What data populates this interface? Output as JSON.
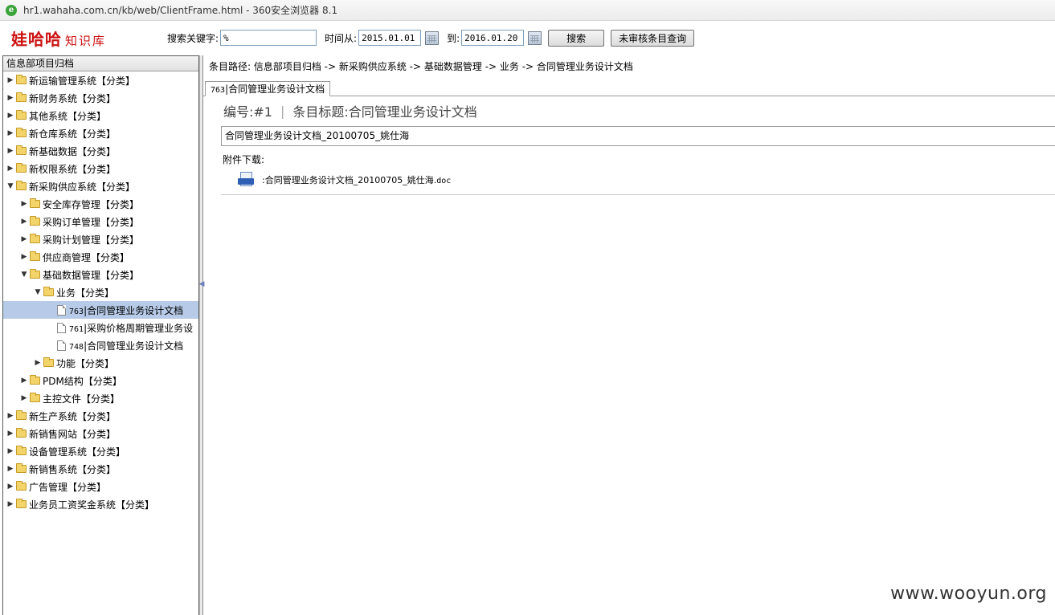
{
  "browser": {
    "title": "hr1.wahaha.com.cn/kb/web/ClientFrame.html - 360安全浏览器 8.1",
    "logo_glyph": "e"
  },
  "toolbar": {
    "logo_main": "娃哈哈",
    "logo_sub": "知识库",
    "keyword_label": "搜索关键字:",
    "keyword_value": "%",
    "time_from_label": "时间从:",
    "date_from": "2015.01.01",
    "time_to_label": "到:",
    "date_to": "2016.01.20",
    "search_button": "搜索",
    "unreviewed_button": "未审核条目查询"
  },
  "left_panel": {
    "header": "信息部项目归档",
    "tree": [
      {
        "label": "新运输管理系统【分类】",
        "indent": 0,
        "arrow": "▶",
        "icon": "folder"
      },
      {
        "label": "新财务系统【分类】",
        "indent": 0,
        "arrow": "▶",
        "icon": "folder"
      },
      {
        "label": "其他系统【分类】",
        "indent": 0,
        "arrow": "▶",
        "icon": "folder"
      },
      {
        "label": "新仓库系统【分类】",
        "indent": 0,
        "arrow": "▶",
        "icon": "folder"
      },
      {
        "label": "新基础数据【分类】",
        "indent": 0,
        "arrow": "▶",
        "icon": "folder"
      },
      {
        "label": "新权限系统【分类】",
        "indent": 0,
        "arrow": "▶",
        "icon": "folder"
      },
      {
        "label": "新采购供应系统【分类】",
        "indent": 0,
        "arrow": "▼",
        "icon": "folder"
      },
      {
        "label": "安全库存管理【分类】",
        "indent": 1,
        "arrow": "▶",
        "icon": "folder"
      },
      {
        "label": "采购订单管理【分类】",
        "indent": 1,
        "arrow": "▶",
        "icon": "folder"
      },
      {
        "label": "采购计划管理【分类】",
        "indent": 1,
        "arrow": "▶",
        "icon": "folder"
      },
      {
        "label": "供应商管理【分类】",
        "indent": 1,
        "arrow": "▶",
        "icon": "folder"
      },
      {
        "label": "基础数据管理【分类】",
        "indent": 1,
        "arrow": "▼",
        "icon": "folder"
      },
      {
        "label": "业务【分类】",
        "indent": 2,
        "arrow": "▼",
        "icon": "folder"
      },
      {
        "id": "763",
        "label": "|合同管理业务设计文档",
        "indent": 3,
        "arrow": "",
        "icon": "doc",
        "selected": true
      },
      {
        "id": "761",
        "label": "|采购价格周期管理业务设",
        "indent": 3,
        "arrow": "",
        "icon": "doc"
      },
      {
        "id": "748",
        "label": "|合同管理业务设计文档",
        "indent": 3,
        "arrow": "",
        "icon": "doc"
      },
      {
        "label": "功能【分类】",
        "indent": 2,
        "arrow": "▶",
        "icon": "folder"
      },
      {
        "label": "PDM结构【分类】",
        "indent": 1,
        "arrow": "▶",
        "icon": "folder"
      },
      {
        "label": "主控文件【分类】",
        "indent": 1,
        "arrow": "▶",
        "icon": "folder"
      },
      {
        "label": "新生产系统【分类】",
        "indent": 0,
        "arrow": "▶",
        "icon": "folder"
      },
      {
        "label": "新销售网站【分类】",
        "indent": 0,
        "arrow": "▶",
        "icon": "folder"
      },
      {
        "label": "设备管理系统【分类】",
        "indent": 0,
        "arrow": "▶",
        "icon": "folder"
      },
      {
        "label": "新销售系统【分类】",
        "indent": 0,
        "arrow": "▶",
        "icon": "folder"
      },
      {
        "label": "广告管理【分类】",
        "indent": 0,
        "arrow": "▶",
        "icon": "folder"
      },
      {
        "label": "业务员工资奖金系统【分类】",
        "indent": 0,
        "arrow": "▶",
        "icon": "folder"
      }
    ]
  },
  "main": {
    "breadcrumb": "条目路径: 信息部项目归档 -> 新采购供应系统 -> 基础数据管理 -> 业务 -> 合同管理业务设计文档",
    "tab": {
      "id": "763",
      "label": "|合同管理业务设计文档"
    },
    "entry_number": "编号:#1",
    "entry_title": "条目标题:合同管理业务设计文档",
    "title_box": "合同管理业务设计文档_20100705_姚仕海",
    "attachment_label": "附件下载:",
    "attachment_name": ":合同管理业务设计文档_20100705_姚仕海.",
    "attachment_ext": "doc"
  },
  "watermark": "www.wooyun.org"
}
